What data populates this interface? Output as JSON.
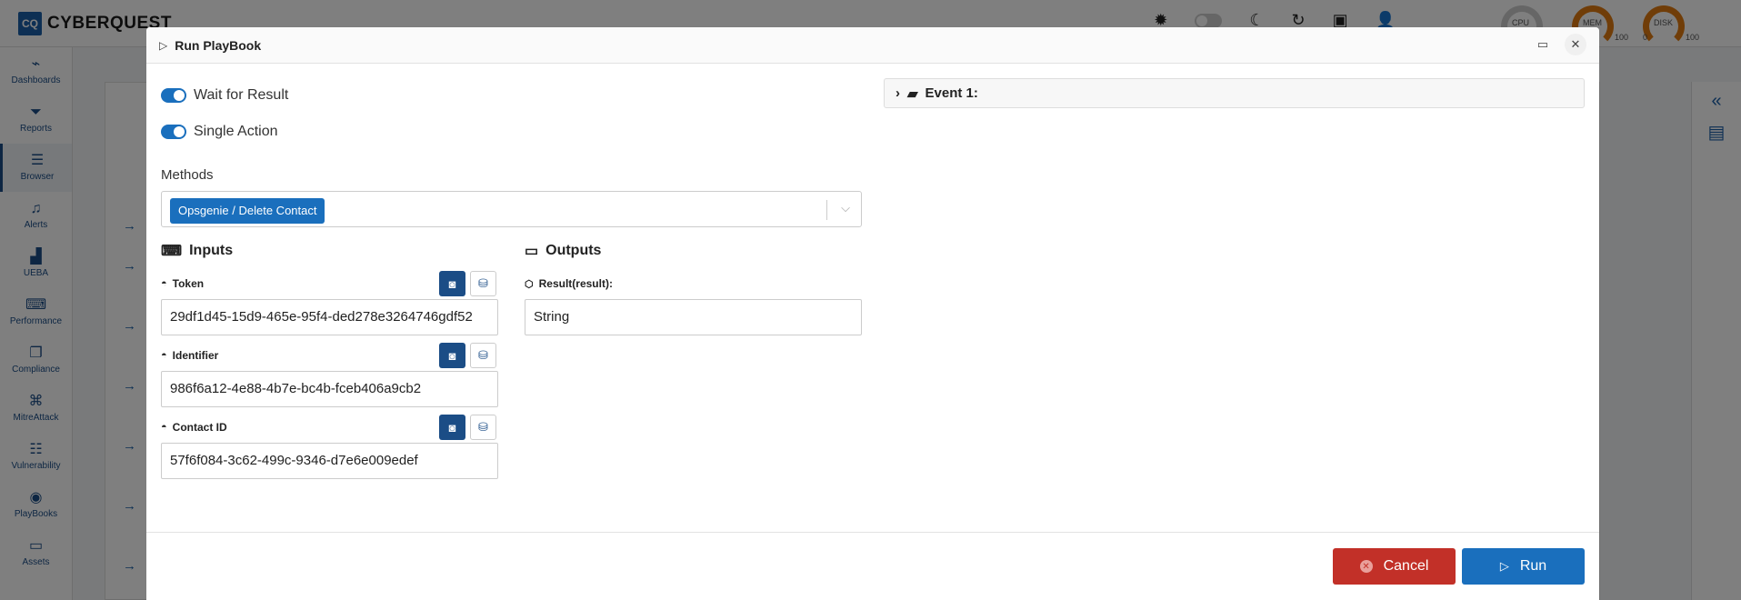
{
  "app": {
    "logo_abbr": "CQ",
    "logo_name": "CYBERQUEST",
    "gauges": [
      {
        "label": "CPU",
        "min": "",
        "max": ""
      },
      {
        "label": "MEM",
        "min": "",
        "max": "100"
      },
      {
        "label": "DISK",
        "min": "0",
        "max": "100"
      }
    ],
    "sidebar": [
      {
        "label": "Dashboards",
        "icon": "chart-line-icon"
      },
      {
        "label": "Reports",
        "icon": "funnel-icon"
      },
      {
        "label": "Browser",
        "icon": "list-icon"
      },
      {
        "label": "Alerts",
        "icon": "bell-icon"
      },
      {
        "label": "UEBA",
        "icon": "bar-chart-icon"
      },
      {
        "label": "Performance",
        "icon": "keyboard-icon"
      },
      {
        "label": "Compliance",
        "icon": "document-gear-icon"
      },
      {
        "label": "MitreAttack",
        "icon": "command-icon"
      },
      {
        "label": "Vulnerability",
        "icon": "server-icon"
      },
      {
        "label": "PlayBooks",
        "icon": "playbook-icon"
      },
      {
        "label": "Assets",
        "icon": "laptop-icon"
      }
    ]
  },
  "modal": {
    "title": "Run PlayBook",
    "wait_for_result_label": "Wait for Result",
    "wait_for_result": true,
    "single_action_label": "Single Action",
    "single_action": true,
    "methods_label": "Methods",
    "selected_method": "Opsgenie / Delete Contact",
    "inputs_title": "Inputs",
    "outputs_title": "Outputs",
    "inputs": [
      {
        "label": "Token",
        "value": "29df1d45-15d9-465e-95f4-ded278e3264746gdf52"
      },
      {
        "label": "Identifier",
        "value": "986f6a12-4e88-4b7e-bc4b-fceb406a9cb2"
      },
      {
        "label": "Contact ID",
        "value": "57f6f084-3c62-499c-9346-d7e6e009edef"
      }
    ],
    "outputs": [
      {
        "label": "Result(result):",
        "value": "String"
      }
    ],
    "event_label": "Event 1:",
    "cancel_label": "Cancel",
    "run_label": "Run"
  },
  "colors": {
    "primary": "#1a6fbd",
    "dark_primary": "#1b4d86",
    "danger": "#c23028"
  }
}
